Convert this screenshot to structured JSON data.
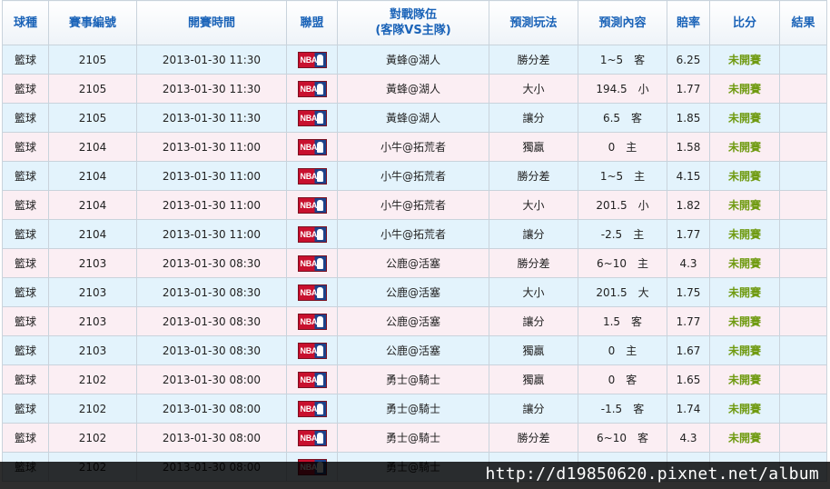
{
  "headers": {
    "sport": "球種",
    "game_no": "賽事編號",
    "start_time": "開賽時間",
    "league": "聯盟",
    "teams_line1": "對戰隊伍",
    "teams_line2": "(客隊VS主隊)",
    "bet_type": "預測玩法",
    "prediction": "預測內容",
    "odds": "賠率",
    "score": "比分",
    "result": "結果"
  },
  "league_icon": "nba-logo-icon",
  "league_logo_text": "NBA",
  "colors": {
    "header_text": "#1a63b8",
    "row_blue": "#e3f3fc",
    "row_pink": "#fbeef3",
    "status_green": "#6f9a10"
  },
  "rows": [
    {
      "sport": "籃球",
      "game_no": "2105",
      "time": "2013-01-30 11:30",
      "matchup": "黃蜂@湖人",
      "bet_type": "勝分差",
      "prediction": "1~5　客",
      "odds": "6.25",
      "score": "未開賽",
      "result": ""
    },
    {
      "sport": "籃球",
      "game_no": "2105",
      "time": "2013-01-30 11:30",
      "matchup": "黃蜂@湖人",
      "bet_type": "大小",
      "prediction": "194.5　小",
      "odds": "1.77",
      "score": "未開賽",
      "result": ""
    },
    {
      "sport": "籃球",
      "game_no": "2105",
      "time": "2013-01-30 11:30",
      "matchup": "黃蜂@湖人",
      "bet_type": "讓分",
      "prediction": "6.5　客",
      "odds": "1.85",
      "score": "未開賽",
      "result": ""
    },
    {
      "sport": "籃球",
      "game_no": "2104",
      "time": "2013-01-30 11:00",
      "matchup": "小牛@拓荒者",
      "bet_type": "獨贏",
      "prediction": "0　主",
      "odds": "1.58",
      "score": "未開賽",
      "result": ""
    },
    {
      "sport": "籃球",
      "game_no": "2104",
      "time": "2013-01-30 11:00",
      "matchup": "小牛@拓荒者",
      "bet_type": "勝分差",
      "prediction": "1~5　主",
      "odds": "4.15",
      "score": "未開賽",
      "result": ""
    },
    {
      "sport": "籃球",
      "game_no": "2104",
      "time": "2013-01-30 11:00",
      "matchup": "小牛@拓荒者",
      "bet_type": "大小",
      "prediction": "201.5　小",
      "odds": "1.82",
      "score": "未開賽",
      "result": ""
    },
    {
      "sport": "籃球",
      "game_no": "2104",
      "time": "2013-01-30 11:00",
      "matchup": "小牛@拓荒者",
      "bet_type": "讓分",
      "prediction": "-2.5　主",
      "odds": "1.77",
      "score": "未開賽",
      "result": ""
    },
    {
      "sport": "籃球",
      "game_no": "2103",
      "time": "2013-01-30 08:30",
      "matchup": "公鹿@活塞",
      "bet_type": "勝分差",
      "prediction": "6~10　主",
      "odds": "4.3",
      "score": "未開賽",
      "result": ""
    },
    {
      "sport": "籃球",
      "game_no": "2103",
      "time": "2013-01-30 08:30",
      "matchup": "公鹿@活塞",
      "bet_type": "大小",
      "prediction": "201.5　大",
      "odds": "1.75",
      "score": "未開賽",
      "result": ""
    },
    {
      "sport": "籃球",
      "game_no": "2103",
      "time": "2013-01-30 08:30",
      "matchup": "公鹿@活塞",
      "bet_type": "讓分",
      "prediction": "1.5　客",
      "odds": "1.77",
      "score": "未開賽",
      "result": ""
    },
    {
      "sport": "籃球",
      "game_no": "2103",
      "time": "2013-01-30 08:30",
      "matchup": "公鹿@活塞",
      "bet_type": "獨贏",
      "prediction": "0　主",
      "odds": "1.67",
      "score": "未開賽",
      "result": ""
    },
    {
      "sport": "籃球",
      "game_no": "2102",
      "time": "2013-01-30 08:00",
      "matchup": "勇士@騎士",
      "bet_type": "獨贏",
      "prediction": "0　客",
      "odds": "1.65",
      "score": "未開賽",
      "result": ""
    },
    {
      "sport": "籃球",
      "game_no": "2102",
      "time": "2013-01-30 08:00",
      "matchup": "勇士@騎士",
      "bet_type": "讓分",
      "prediction": "-1.5　客",
      "odds": "1.74",
      "score": "未開賽",
      "result": ""
    },
    {
      "sport": "籃球",
      "game_no": "2102",
      "time": "2013-01-30 08:00",
      "matchup": "勇士@騎士",
      "bet_type": "勝分差",
      "prediction": "6~10　客",
      "odds": "4.3",
      "score": "未開賽",
      "result": ""
    },
    {
      "sport": "籃球",
      "game_no": "2102",
      "time": "2013-01-30 08:00",
      "matchup": "勇士@騎士",
      "bet_type": "",
      "prediction": "",
      "odds": "",
      "score": "",
      "result": ""
    }
  ],
  "watermark": "http://d19850620.pixnet.net/album"
}
